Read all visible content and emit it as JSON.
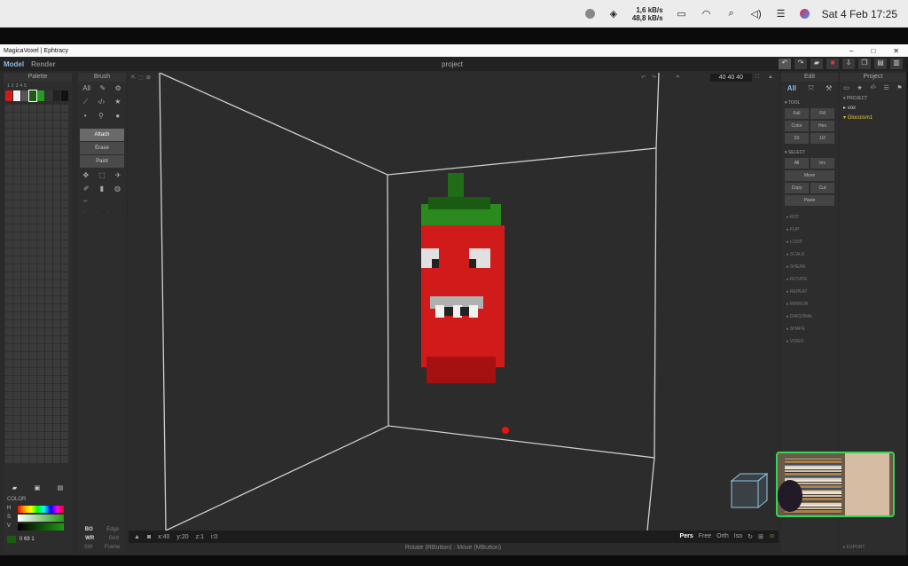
{
  "macbar": {
    "net_up": "1,6 kB/s",
    "net_down": "48,8 kB/s",
    "datetime": "Sat 4 Feb  17:25"
  },
  "window": {
    "title": "MagicaVoxel | Ephtracy"
  },
  "menubar": {
    "model": "Model",
    "render": "Render",
    "project": "project"
  },
  "palette": {
    "title": "Palette",
    "tabs": [
      "1",
      "2",
      "3",
      "4",
      "5"
    ]
  },
  "brush": {
    "title": "Brush",
    "all": "All",
    "modes": [
      "Attach",
      "Erase",
      "Paint"
    ]
  },
  "color": {
    "title": "COLOR",
    "h": "H",
    "s": "S",
    "v": "V",
    "value": "0 69 1"
  },
  "brush_bottom": {
    "bo": "BO",
    "edge": "Edge",
    "wr": "WR",
    "grid": "Grid",
    "sw": "SW",
    "frame": "Frame"
  },
  "viewport": {
    "dims": "40  40  40"
  },
  "status": {
    "x": "x:40",
    "y": "y:20",
    "z": "z:1",
    "i": "i:0",
    "views": [
      "Pers",
      "Free",
      "Orth",
      "Iso"
    ]
  },
  "hint": "Rotate (RButton) : Move (MButton)",
  "edit": {
    "title": "Edit",
    "all": "All",
    "tool": "TOOL",
    "tool_btns": [
      [
        "Full",
        "Fill"
      ],
      [
        "Color",
        "Hex"
      ],
      [
        "3X",
        "1/2"
      ]
    ],
    "select": "SELECT",
    "select_btns": [
      [
        "All",
        "Inv"
      ]
    ],
    "move": "Move",
    "copy_cut": [
      "Copy",
      "Cut"
    ],
    "paste": "Paste",
    "collapsed": [
      "ROT",
      "FLIP",
      "LOOP",
      "SCALE",
      "SHEAR",
      "ROTATE",
      "REPEAT",
      "MIRROR",
      "DIAGONAL",
      "SHAPE",
      "VIDEO"
    ]
  },
  "project": {
    "title": "Project",
    "section": "PROJECT",
    "items": [
      "vox",
      "Glocoism1"
    ],
    "export": "EXPORT"
  },
  "colors": {
    "accent": "#8fb7e0",
    "voxel_red": "#d11b1b",
    "voxel_green": "#2a7a1e",
    "selected_yellow": "#e8c82e",
    "webcam_border": "#39d353"
  }
}
